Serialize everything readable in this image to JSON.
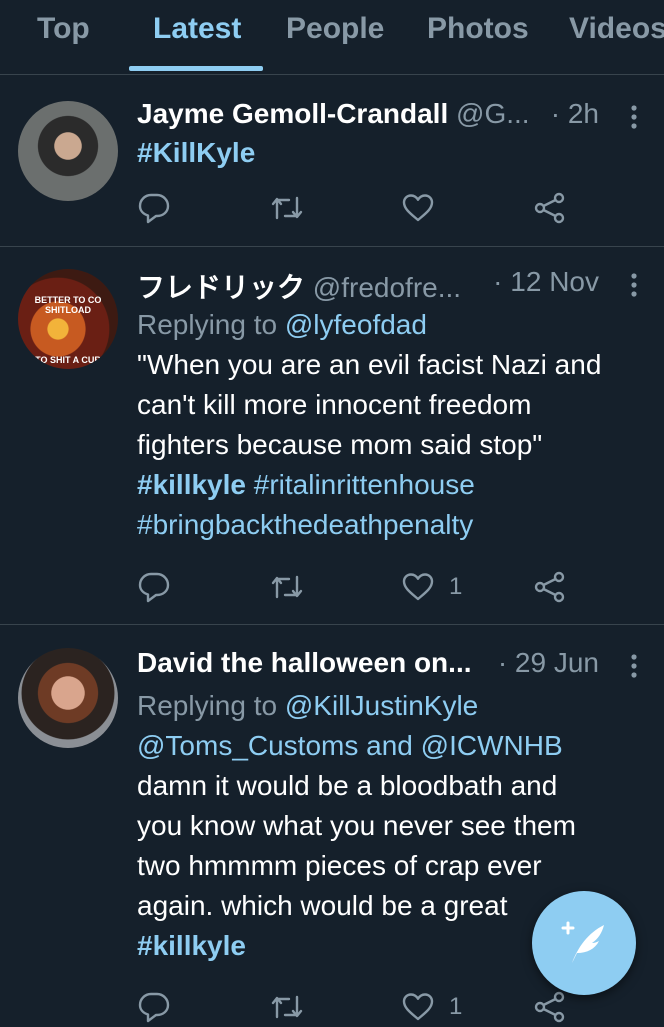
{
  "tabs": [
    {
      "label": "Top",
      "active": false
    },
    {
      "label": "Latest",
      "active": true
    },
    {
      "label": "People",
      "active": false
    },
    {
      "label": "Photos",
      "active": false
    },
    {
      "label": "Videos",
      "active": false
    }
  ],
  "tweets": [
    {
      "name": "Jayme Gemoll-Crandall",
      "handle": "@G...",
      "time": "2h",
      "body_lines": [
        "#KillKyle"
      ],
      "reply_count": "",
      "retweet_count": "",
      "like_count": ""
    },
    {
      "name": "フレドリック",
      "handle": "@fredofre...",
      "time": "12 Nov",
      "avatar_text_top": "BETTER TO CO SHITLOAD",
      "avatar_text_bottom": "TO SHIT A CUR",
      "reply_to_prefix": "Replying to",
      "reply_to_handle": "@lyfeofdad",
      "body_lines": [
        "\"When you are an evil facist Nazi and",
        "can't kill more innocent freedom",
        "fighters because mom said stop\""
      ],
      "hashtag_1": "#killkyle",
      "hashtag_2": "#ritalinrittenhouse",
      "hashtag_3": "#bringbackthedeathpenalty",
      "like_count": "1"
    },
    {
      "name": "David the halloween on...",
      "handle": "",
      "time": "29 Jun",
      "reply_to_prefix": "Replying to",
      "reply_to_handle": "@KillJustinKyle",
      "reply_to_handle_2": "@Toms_Customs",
      "reply_to_and": "and",
      "reply_to_handle_3": "@ICWNHB",
      "body_lines": [
        "damn it would be a bloodbath and",
        "you know what you never see them",
        "two hmmmm pieces of crap ever",
        "again.  which would be a great"
      ],
      "hashtag_1": "#killkyle",
      "like_count": "1"
    }
  ],
  "separator_dot": "·",
  "icons": {
    "more": "more-vertical-icon",
    "reply": "reply-icon",
    "retweet": "retweet-icon",
    "like": "heart-icon",
    "share": "share-icon",
    "compose": "compose-feather-icon"
  },
  "colors": {
    "background": "#15202b",
    "accent": "#8ecdf2",
    "muted": "#8899a6",
    "divider": "#38444d"
  }
}
